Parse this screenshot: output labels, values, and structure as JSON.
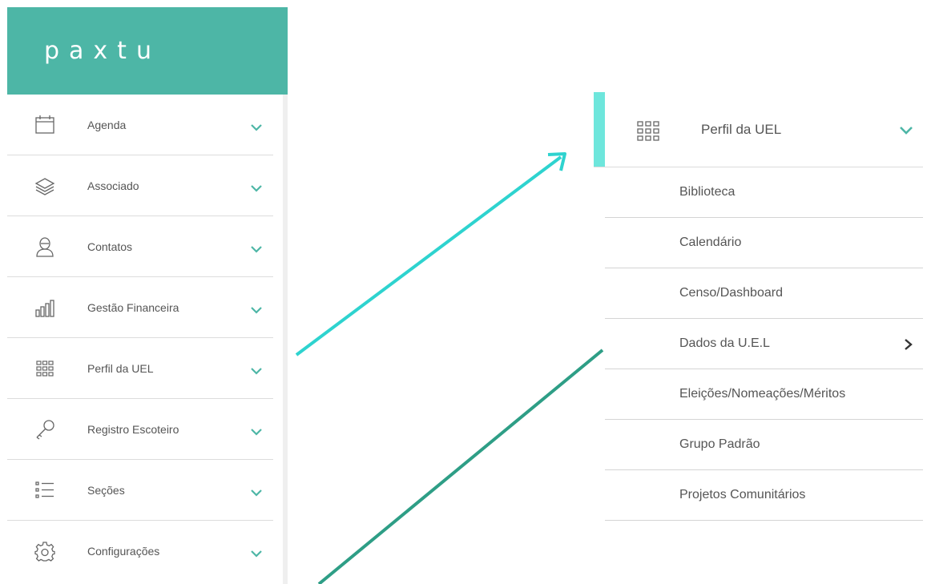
{
  "brand": {
    "logo_text": "paxtu",
    "color": "#4db6a6"
  },
  "sidebar": {
    "items": [
      {
        "label": "Agenda",
        "icon": "calendar-icon"
      },
      {
        "label": "Associado",
        "icon": "layers-icon"
      },
      {
        "label": "Contatos",
        "icon": "user-icon"
      },
      {
        "label": "Gestão Financeira",
        "icon": "bar-chart-icon"
      },
      {
        "label": "Perfil da UEL",
        "icon": "grid-icon"
      },
      {
        "label": "Registro Escoteiro",
        "icon": "key-icon"
      },
      {
        "label": "Seções",
        "icon": "list-icon"
      },
      {
        "label": "Configurações",
        "icon": "gear-icon"
      }
    ],
    "chevron_color": "#4db6a6"
  },
  "submenu": {
    "header": {
      "label": "Perfil da UEL",
      "icon": "grid-icon"
    },
    "accent_color": "#6ee6dc",
    "items": [
      {
        "label": "Biblioteca"
      },
      {
        "label": "Calendário"
      },
      {
        "label": "Censo/Dashboard"
      },
      {
        "label": "Dados da U.E.L",
        "has_submenu": true
      },
      {
        "label": "Eleições/Nomeações/Méritos"
      },
      {
        "label": "Grupo Padrão"
      },
      {
        "label": "Projetos Comunitários"
      }
    ]
  },
  "arrows": {
    "primary_color": "#2ed3cf",
    "secondary_color": "#2e9e86"
  }
}
